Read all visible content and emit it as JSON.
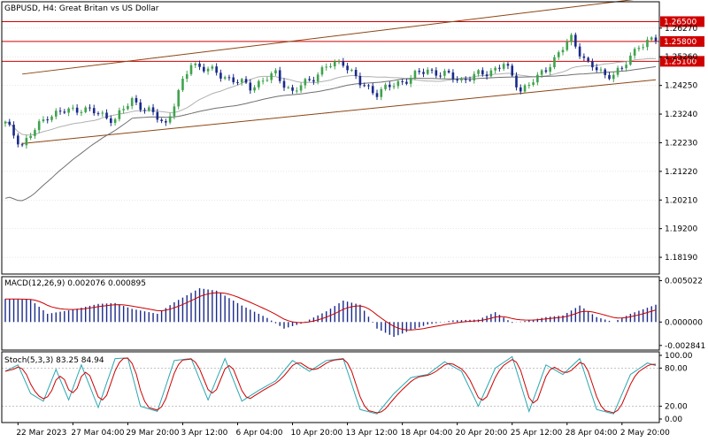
{
  "colors": {
    "up": "#3fa34d",
    "down": "#1a2a8a",
    "macd_hist": "#1a2a8a",
    "signal": "#cc0000",
    "stoch_main": "#2aa6b0",
    "stoch_signal": "#cc0000",
    "ma_fast": "#b0b0b0",
    "ma_slow": "#707070",
    "trend": "#8b4513",
    "level": "#d00000",
    "grid": "#d0d0d0",
    "border": "#000000"
  },
  "chart_data": [
    {
      "panel": "price",
      "type": "candlestick",
      "title": "GBPUSD, H4:  Great Britan vs US Dollar",
      "ylim": [
        1.176,
        1.272
      ],
      "y_ticks": [
        "1.26270",
        "1.25260",
        "1.24250",
        "1.23240",
        "1.22230",
        "1.21220",
        "1.20210",
        "1.19200",
        "1.18190"
      ],
      "price_levels": [
        {
          "value": 1.265,
          "label": "1.26500"
        },
        {
          "value": 1.258,
          "label": "1.25800"
        },
        {
          "value": 1.251,
          "label": "1.25100"
        }
      ],
      "trend_lines": [
        {
          "from": [
            4,
            1.2465
          ],
          "to": [
            150,
            1.273
          ]
        },
        {
          "from": [
            4,
            1.222
          ],
          "to": [
            154,
            1.2445
          ]
        }
      ],
      "anchors": [
        [
          0,
          1.229
        ],
        [
          4,
          1.2215
        ],
        [
          10,
          1.232
        ],
        [
          18,
          1.2345
        ],
        [
          26,
          1.2305
        ],
        [
          30,
          1.2375
        ],
        [
          38,
          1.229
        ],
        [
          44,
          1.2505
        ],
        [
          48,
          1.248
        ],
        [
          58,
          1.242
        ],
        [
          64,
          1.2465
        ],
        [
          68,
          1.24
        ],
        [
          76,
          1.249
        ],
        [
          80,
          1.251
        ],
        [
          84,
          1.243
        ],
        [
          88,
          1.24
        ],
        [
          94,
          1.244
        ],
        [
          100,
          1.248
        ],
        [
          108,
          1.2445
        ],
        [
          114,
          1.247
        ],
        [
          118,
          1.25
        ],
        [
          122,
          1.241
        ],
        [
          126,
          1.245
        ],
        [
          130,
          1.252
        ],
        [
          134,
          1.259
        ],
        [
          138,
          1.25
        ],
        [
          142,
          1.246
        ],
        [
          146,
          1.248
        ],
        [
          150,
          1.257
        ],
        [
          154,
          1.2585
        ]
      ],
      "x_tick_labels": [
        {
          "bar": 3,
          "label": "22 Mar 2023"
        },
        {
          "bar": 16,
          "label": "27 Mar 04:00"
        },
        {
          "bar": 29,
          "label": "29 Mar 20:00"
        },
        {
          "bar": 42,
          "label": "3 Apr 12:00"
        },
        {
          "bar": 55,
          "label": "6 Apr 04:00"
        },
        {
          "bar": 68,
          "label": "10 Apr 20:00"
        },
        {
          "bar": 81,
          "label": "13 Apr 12:00"
        },
        {
          "bar": 94,
          "label": "18 Apr 04:00"
        },
        {
          "bar": 107,
          "label": "20 Apr 20:00"
        },
        {
          "bar": 120,
          "label": "25 Apr 12:00"
        },
        {
          "bar": 133,
          "label": "28 Apr 04:00"
        },
        {
          "bar": 146,
          "label": "2 May 20:00"
        }
      ],
      "bars": 155
    },
    {
      "panel": "macd",
      "type": "histogram",
      "title": "MACD(12,26,9) 0.002076 0.000895",
      "ylim": [
        -0.0034,
        0.0055
      ],
      "y_ticks": [
        "0.005022",
        "0.000000",
        "-0.002841"
      ],
      "hist_anchors": [
        [
          0,
          0.0028
        ],
        [
          6,
          0.0027
        ],
        [
          10,
          0.001
        ],
        [
          16,
          0.0015
        ],
        [
          22,
          0.0022
        ],
        [
          26,
          0.0023
        ],
        [
          30,
          0.0016
        ],
        [
          36,
          0.001
        ],
        [
          40,
          0.0024
        ],
        [
          46,
          0.0041
        ],
        [
          50,
          0.0038
        ],
        [
          56,
          0.002
        ],
        [
          62,
          0.0005
        ],
        [
          66,
          -0.0008
        ],
        [
          70,
          -0.0002
        ],
        [
          76,
          0.0013
        ],
        [
          80,
          0.0026
        ],
        [
          84,
          0.0021
        ],
        [
          88,
          -0.0008
        ],
        [
          92,
          -0.0018
        ],
        [
          96,
          -0.001
        ],
        [
          100,
          -0.0003
        ],
        [
          106,
          0.0002
        ],
        [
          112,
          0.0003
        ],
        [
          116,
          0.0012
        ],
        [
          120,
          -0.0001
        ],
        [
          124,
          0.0002
        ],
        [
          128,
          0.0006
        ],
        [
          132,
          0.0008
        ],
        [
          136,
          0.002
        ],
        [
          140,
          0.0006
        ],
        [
          144,
          0.0
        ],
        [
          148,
          0.001
        ],
        [
          154,
          0.0021
        ]
      ]
    },
    {
      "panel": "stochastic",
      "type": "line",
      "title": "Stoch(5,3,3) 83.25 84.94",
      "ylim": [
        0,
        100
      ],
      "y_ticks": [
        "100.00",
        "80.00",
        "20.00",
        "0.00"
      ],
      "k_anchors": [
        [
          0,
          75
        ],
        [
          3,
          85
        ],
        [
          6,
          40
        ],
        [
          9,
          28
        ],
        [
          12,
          78
        ],
        [
          15,
          30
        ],
        [
          18,
          85
        ],
        [
          22,
          18
        ],
        [
          26,
          95
        ],
        [
          29,
          96
        ],
        [
          32,
          20
        ],
        [
          36,
          12
        ],
        [
          40,
          92
        ],
        [
          44,
          95
        ],
        [
          48,
          30
        ],
        [
          52,
          95
        ],
        [
          56,
          28
        ],
        [
          60,
          45
        ],
        [
          64,
          60
        ],
        [
          68,
          92
        ],
        [
          72,
          75
        ],
        [
          76,
          92
        ],
        [
          80,
          95
        ],
        [
          84,
          15
        ],
        [
          88,
          8
        ],
        [
          92,
          40
        ],
        [
          96,
          65
        ],
        [
          100,
          70
        ],
        [
          104,
          90
        ],
        [
          108,
          75
        ],
        [
          112,
          20
        ],
        [
          116,
          80
        ],
        [
          120,
          98
        ],
        [
          124,
          12
        ],
        [
          128,
          85
        ],
        [
          132,
          70
        ],
        [
          136,
          95
        ],
        [
          140,
          15
        ],
        [
          144,
          8
        ],
        [
          148,
          70
        ],
        [
          152,
          88
        ],
        [
          154,
          84
        ]
      ]
    }
  ]
}
